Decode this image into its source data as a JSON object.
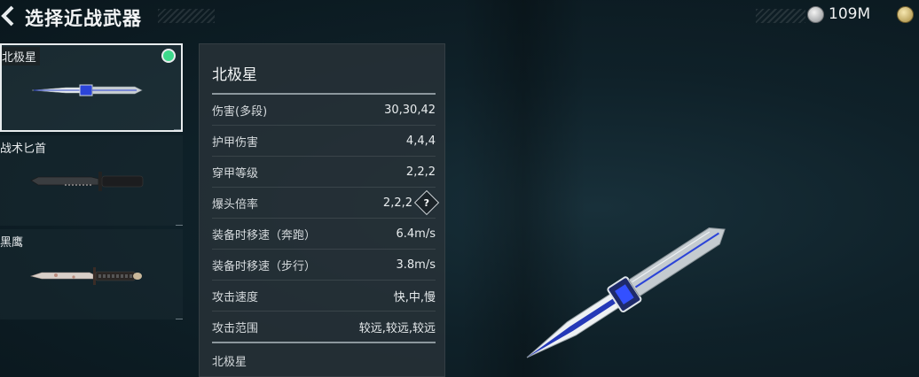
{
  "header": {
    "title": "选择近战武器",
    "currency_value": "109M"
  },
  "weapons": [
    {
      "name": "北极星",
      "selected": true
    },
    {
      "name": "战术匕首",
      "selected": false
    },
    {
      "name": "黑鹰",
      "selected": false
    }
  ],
  "details": {
    "name": "北极星",
    "stats": [
      {
        "label": "伤害(多段)",
        "value": "30,30,42"
      },
      {
        "label": "护甲伤害",
        "value": "4,4,4"
      },
      {
        "label": "穿甲等级",
        "value": "2,2,2"
      },
      {
        "label": "爆头倍率",
        "value": "2,2,2"
      },
      {
        "label": "装备时移速（奔跑）",
        "value": "6.4m/s"
      },
      {
        "label": "装备时移速（步行）",
        "value": "3.8m/s"
      },
      {
        "label": "攻击速度",
        "value": "快,中,慢"
      },
      {
        "label": "攻击范围",
        "value": "较远,较远,较远"
      }
    ],
    "footer": "北极星"
  },
  "colors": {
    "selected_dot": "#3dd98b",
    "accent_blue": "#2b44d8"
  }
}
